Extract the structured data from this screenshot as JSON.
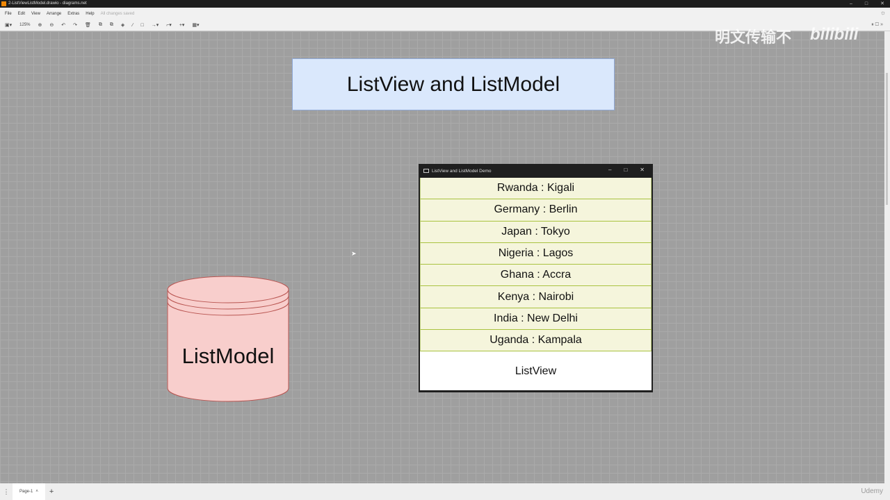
{
  "window": {
    "title": "2-ListViewListModel.drawio - diagrams.net",
    "min": "–",
    "max": "□",
    "close": "✕"
  },
  "menu": {
    "items": [
      "File",
      "Edit",
      "View",
      "Arrange",
      "Extras",
      "Help"
    ],
    "status": "All changes saved"
  },
  "toolbar": {
    "zoom": "125%"
  },
  "diagram": {
    "title": "ListView and ListModel",
    "cylinder_label": "ListModel"
  },
  "app": {
    "title": "ListView and ListModel Demo",
    "rows": [
      "Rwanda : Kigali",
      "Germany : Berlin",
      "Japan : Tokyo",
      "Nigeria : Lagos",
      "Ghana : Accra",
      "Kenya : Nairobi",
      "India : New Delhi",
      "Uganda : Kampala"
    ],
    "caption": "ListView"
  },
  "pages": {
    "tab": "Page-1",
    "add": "+"
  },
  "overlay": {
    "watermark": "明文传输不",
    "brand": "bilibili",
    "udemy": "Udemy"
  }
}
